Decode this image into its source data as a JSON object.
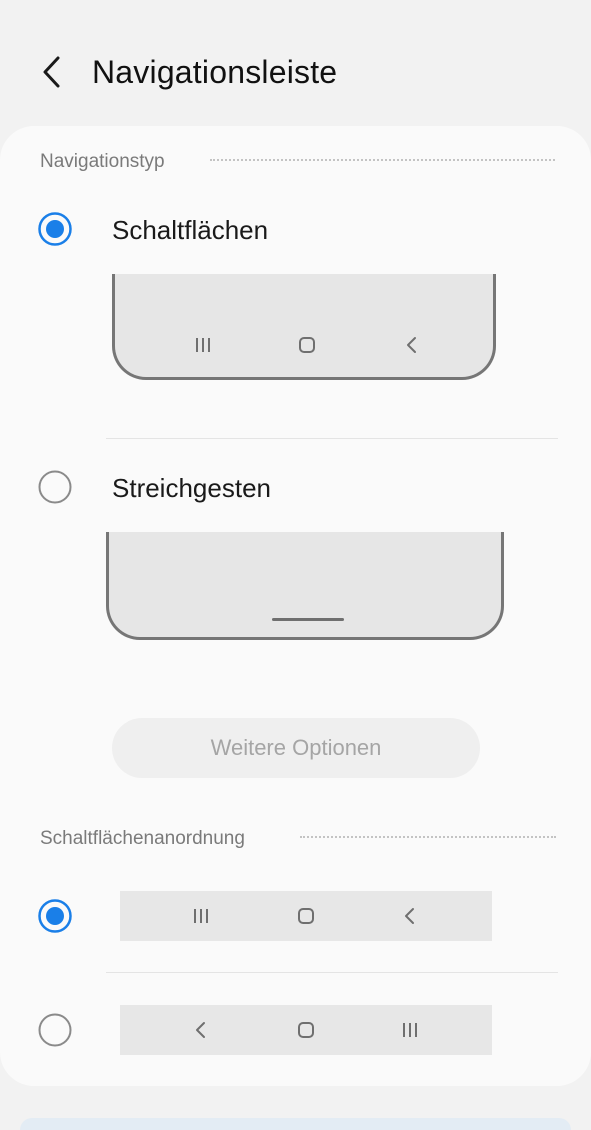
{
  "header": {
    "title": "Navigationsleiste",
    "back_icon": "chevron-left-icon"
  },
  "navigation_type": {
    "section_label": "Navigationstyp",
    "options": [
      {
        "label": "Schaltflächen",
        "selected": true
      },
      {
        "label": "Streichgesten",
        "selected": false
      }
    ]
  },
  "more_options": {
    "label": "Weitere Optionen",
    "enabled": false
  },
  "button_order": {
    "section_label": "Schaltflächenanordnung",
    "options": [
      {
        "selected": true,
        "icons": [
          "recents-icon",
          "home-icon",
          "back-icon"
        ]
      },
      {
        "selected": false,
        "icons": [
          "back-icon",
          "home-icon",
          "recents-icon"
        ]
      }
    ]
  },
  "colors": {
    "accent": "#1a7fe8",
    "card_bg": "#fafafa",
    "page_bg": "#f2f2f2"
  }
}
